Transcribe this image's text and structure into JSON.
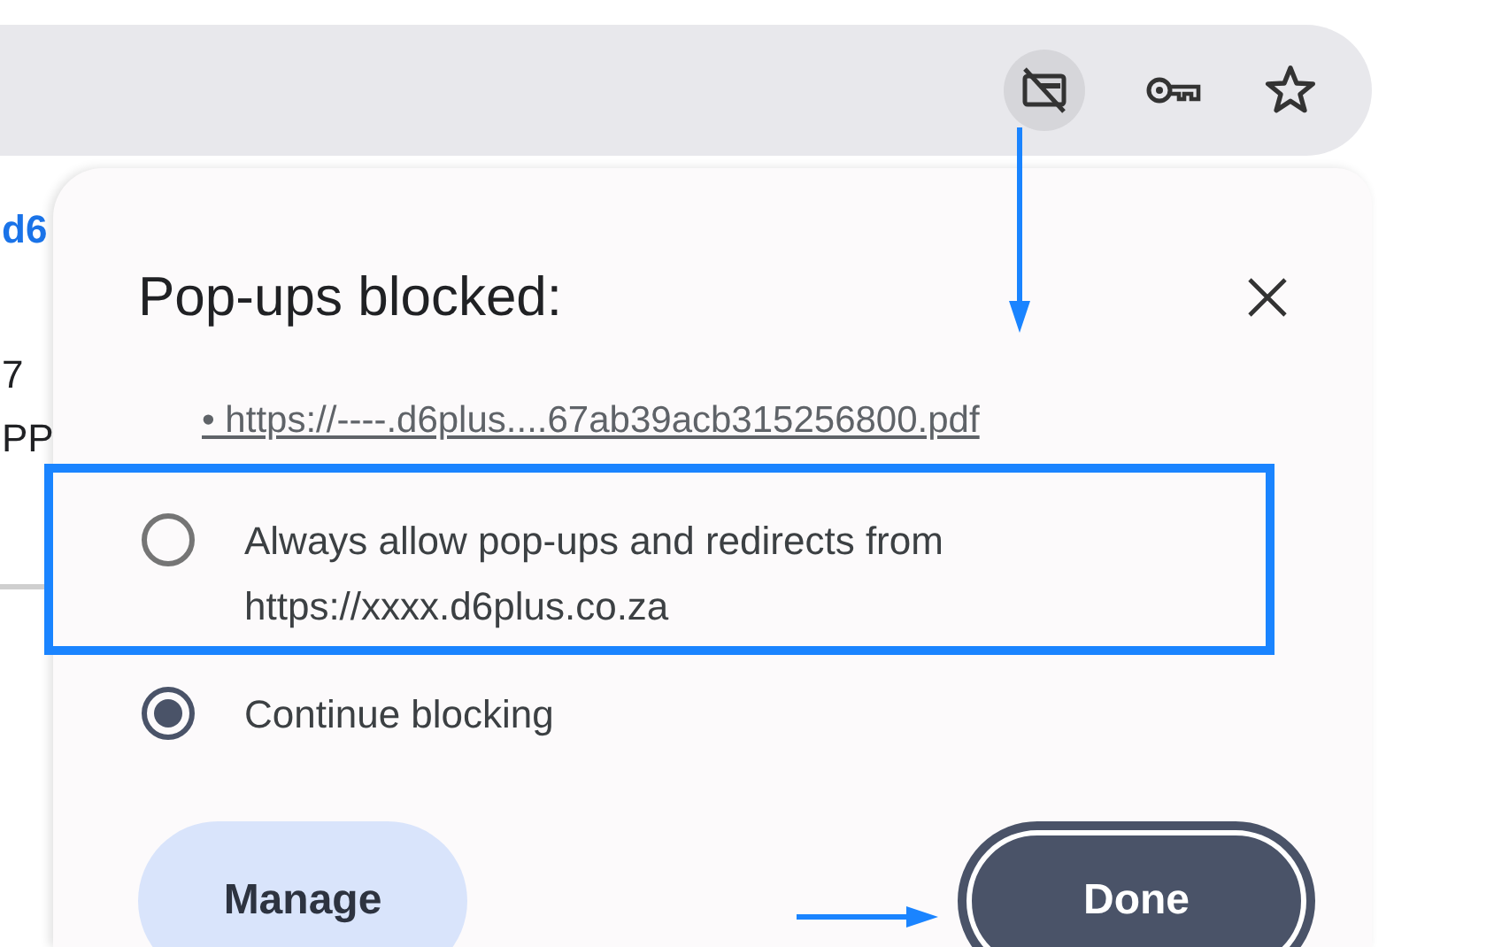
{
  "background_page": {
    "texts": [
      {
        "text": "d6",
        "kind": "link"
      },
      {
        "text": "7",
        "kind": "plain"
      },
      {
        "text": "PP",
        "kind": "plain"
      }
    ]
  },
  "popup": {
    "title": "Pop-ups blocked:",
    "blocked_items": [
      "•  https://----.d6plus....67ab39acb315256800.pdf"
    ],
    "options": [
      {
        "label": "Always allow pop-ups and redirects from https://xxxx.d6plus.co.za",
        "selected": false
      },
      {
        "label": "Continue blocking",
        "selected": true
      }
    ],
    "buttons": [
      {
        "label": "Manage",
        "kind": "secondary"
      },
      {
        "label": "Done",
        "kind": "primary"
      }
    ]
  }
}
